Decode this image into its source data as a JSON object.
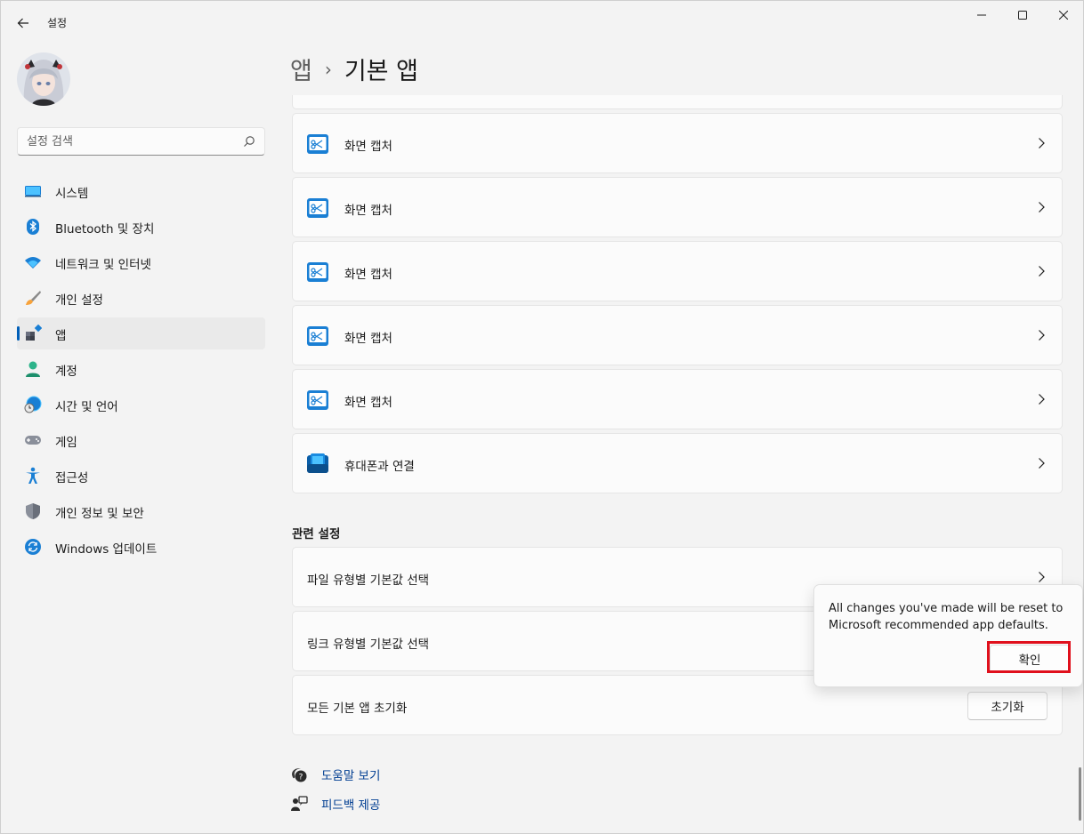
{
  "window": {
    "title": "설정"
  },
  "search": {
    "placeholder": "설정 검색"
  },
  "sidebar": {
    "items": [
      {
        "label": "시스템",
        "icon": "system-icon"
      },
      {
        "label": "Bluetooth 및 장치",
        "icon": "bluetooth-icon"
      },
      {
        "label": "네트워크 및 인터넷",
        "icon": "wifi-icon"
      },
      {
        "label": "개인 설정",
        "icon": "brush-icon"
      },
      {
        "label": "앱",
        "icon": "apps-icon",
        "active": true
      },
      {
        "label": "계정",
        "icon": "account-icon"
      },
      {
        "label": "시간 및 언어",
        "icon": "globe-clock-icon"
      },
      {
        "label": "게임",
        "icon": "gamepad-icon"
      },
      {
        "label": "접근성",
        "icon": "accessibility-icon"
      },
      {
        "label": "개인 정보 및 보안",
        "icon": "shield-icon"
      },
      {
        "label": "Windows 업데이트",
        "icon": "update-icon"
      }
    ]
  },
  "breadcrumb": {
    "parent": "앱",
    "separator": "›",
    "current": "기본 앱"
  },
  "apps": [
    {
      "label": "화면 캡처",
      "icon": "snipping-tool-icon"
    },
    {
      "label": "화면 캡처",
      "icon": "snipping-tool-icon"
    },
    {
      "label": "화면 캡처",
      "icon": "snipping-tool-icon"
    },
    {
      "label": "화면 캡처",
      "icon": "snipping-tool-icon"
    },
    {
      "label": "화면 캡처",
      "icon": "snipping-tool-icon"
    },
    {
      "label": "휴대폰과 연결",
      "icon": "phone-link-icon"
    }
  ],
  "related": {
    "title": "관련 설정",
    "items": [
      {
        "label": "파일 유형별 기본값 선택"
      },
      {
        "label": "링크 유형별 기본값 선택"
      },
      {
        "label": "모든 기본 앱 초기화",
        "button": "초기화"
      }
    ]
  },
  "help": {
    "help_label": "도움말 보기",
    "feedback_label": "피드백 제공"
  },
  "flyout": {
    "message": "All changes you've made will be reset to Microsoft recommended app defaults.",
    "confirm_label": "확인"
  },
  "colors": {
    "accent": "#005fb8",
    "highlight": "#e0101c",
    "link": "#003e92"
  }
}
